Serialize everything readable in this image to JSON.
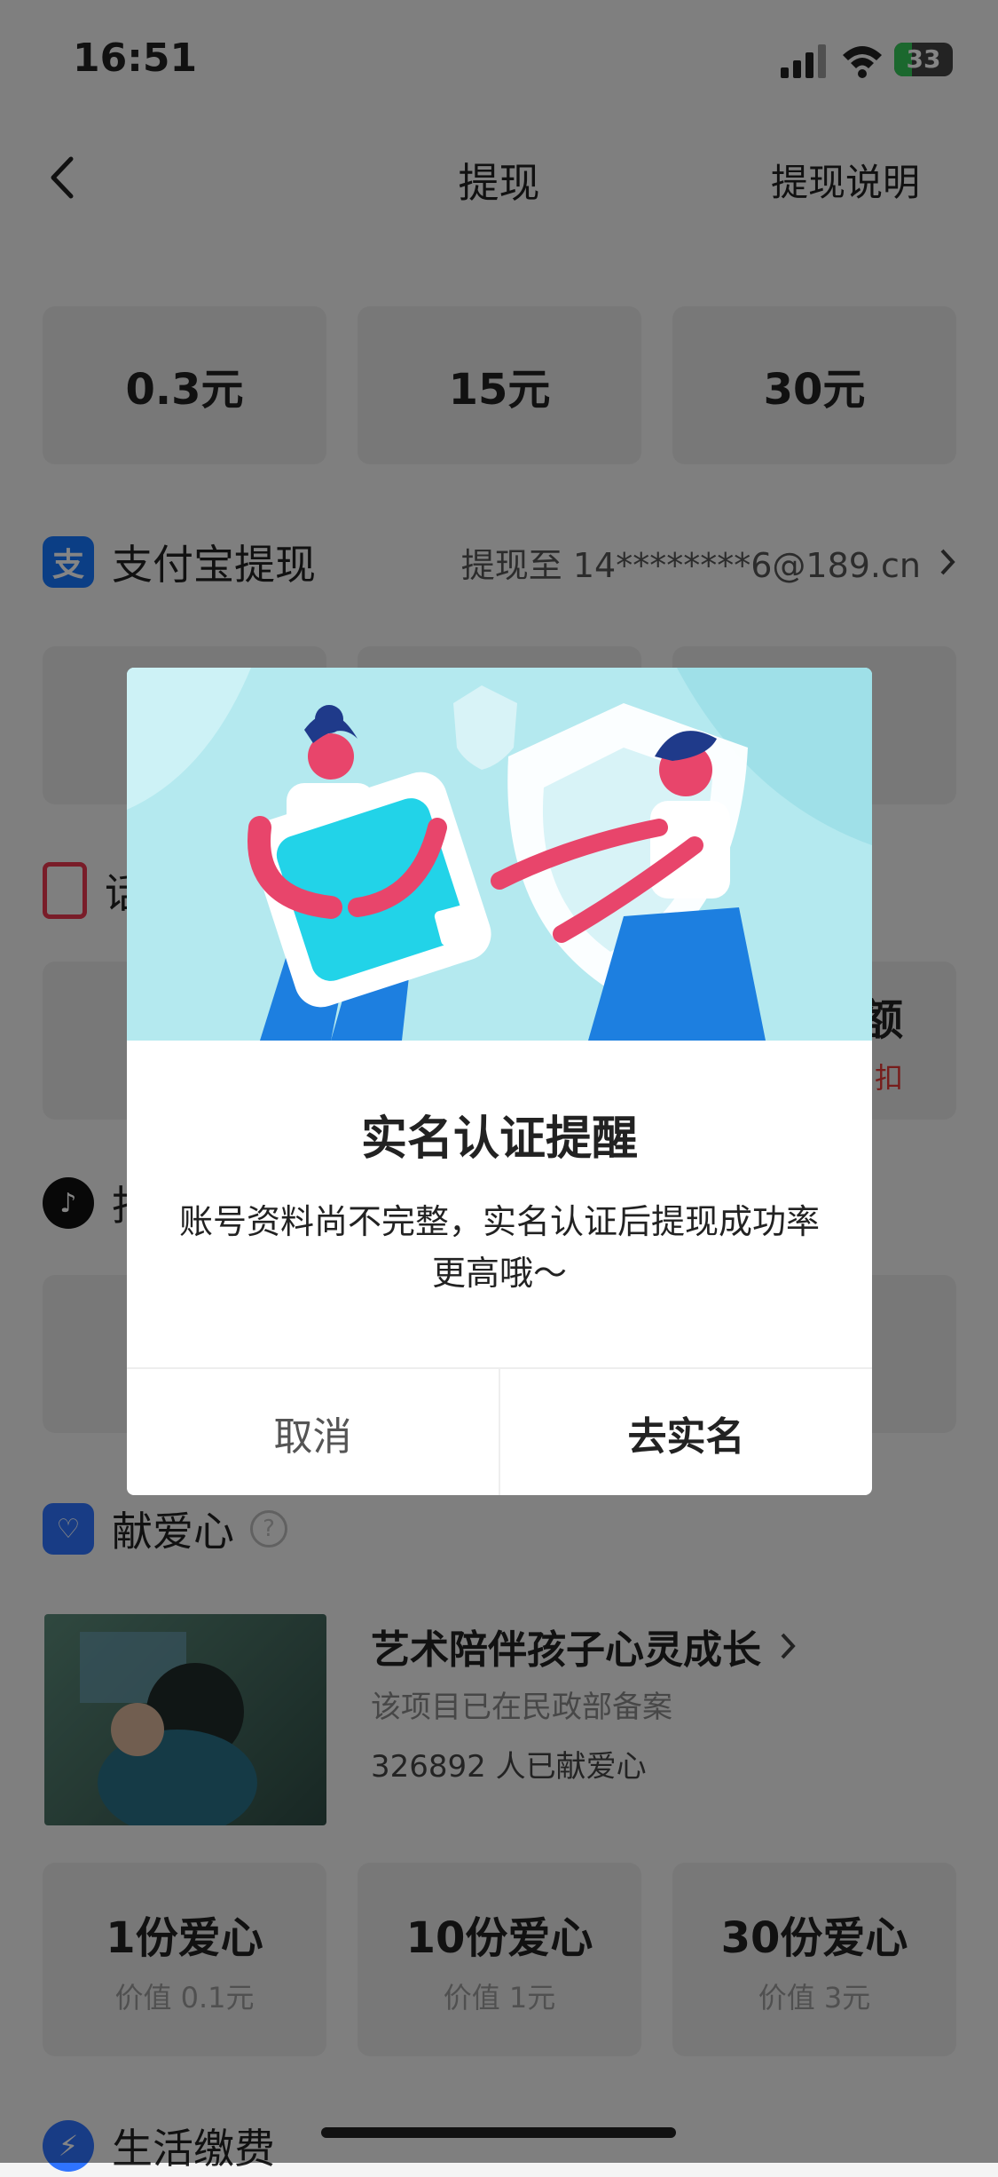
{
  "status_bar": {
    "time": "16:51",
    "battery": "33"
  },
  "nav": {
    "title": "提现",
    "right_link": "提现说明"
  },
  "bank_amounts": [
    "0.3元",
    "15元",
    "30元"
  ],
  "alipay": {
    "title": "支付宝提现",
    "target": "提现至 14********6@189.cn"
  },
  "phone_section": {
    "title_visible": "话",
    "box_partial_title": "额",
    "box_partial_note": "扣"
  },
  "douyin_section": {
    "title_visible": "抖"
  },
  "donate": {
    "title": "献爱心",
    "project_title": "艺术陪伴孩子心灵成长",
    "project_sub": "该项目已在民政部备案",
    "project_count": "326892 人已献爱心",
    "options": [
      {
        "title": "1份爱心",
        "sub": "价值 0.1元"
      },
      {
        "title": "10份爱心",
        "sub": "价值 1元"
      },
      {
        "title": "30份爱心",
        "sub": "价值 3元"
      }
    ]
  },
  "life_section": {
    "title": "生活缴费"
  },
  "modal": {
    "title": "实名认证提醒",
    "message": "账号资料尚不完整，实名认证后提现成功率更高哦～",
    "cancel": "取消",
    "confirm": "去实名"
  },
  "colors": {
    "alipay": "#1677ff",
    "phone": "#e8384f",
    "douyin": "#111111",
    "donate": "#2f74ff",
    "life": "#2f74ff",
    "modal_art_bg": "#b4e9ef"
  }
}
